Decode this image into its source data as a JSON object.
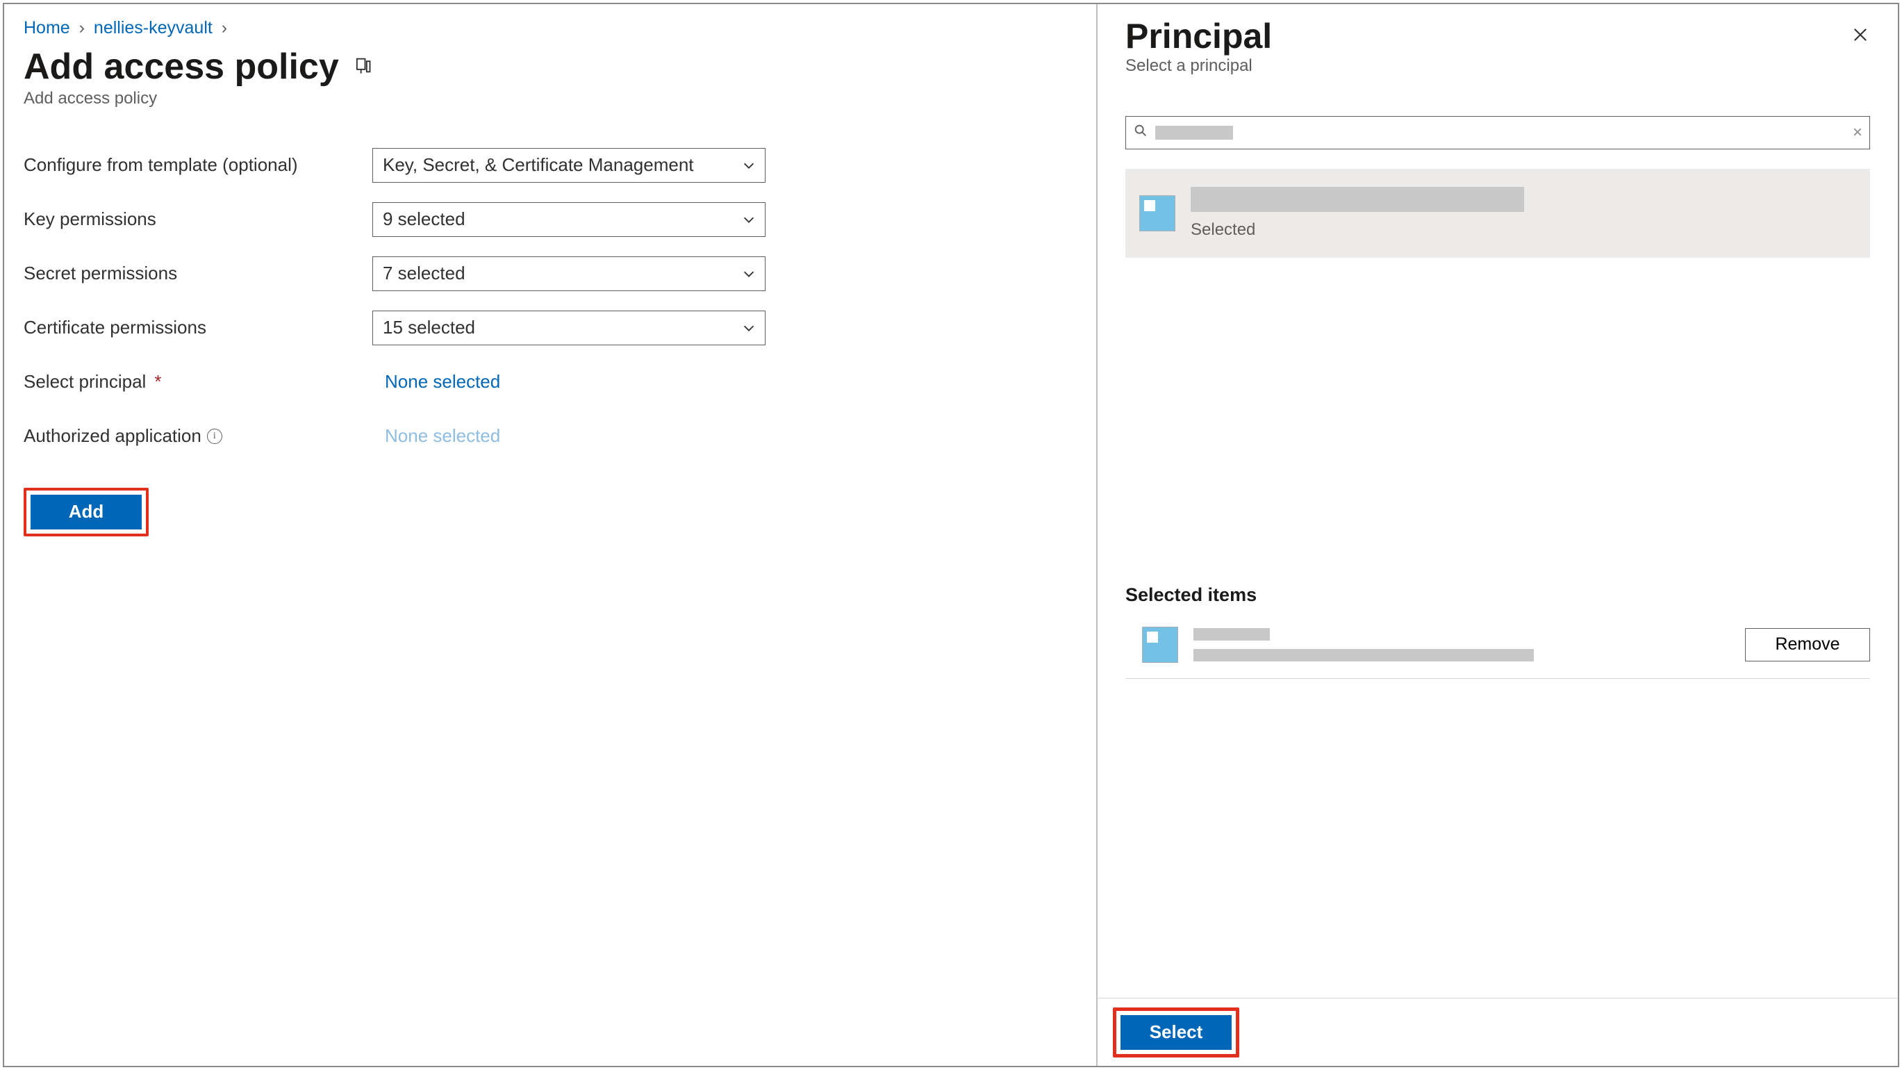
{
  "breadcrumb": {
    "home": "Home",
    "item": "nellies-keyvault",
    "sep": "›"
  },
  "header": {
    "title": "Add access policy",
    "subtitle": "Add access policy"
  },
  "form": {
    "template_label": "Configure from template (optional)",
    "template_value": "Key, Secret, & Certificate Management",
    "key_label": "Key permissions",
    "key_value": "9 selected",
    "secret_label": "Secret permissions",
    "secret_value": "7 selected",
    "cert_label": "Certificate permissions",
    "cert_value": "15 selected",
    "principal_label": "Select principal",
    "principal_value": "None selected",
    "app_label": "Authorized application",
    "app_value": "None selected",
    "add_button": "Add"
  },
  "blade": {
    "title": "Principal",
    "subtitle": "Select a principal",
    "result_status": "Selected",
    "selected_heading": "Selected items",
    "remove_button": "Remove",
    "select_button": "Select"
  }
}
